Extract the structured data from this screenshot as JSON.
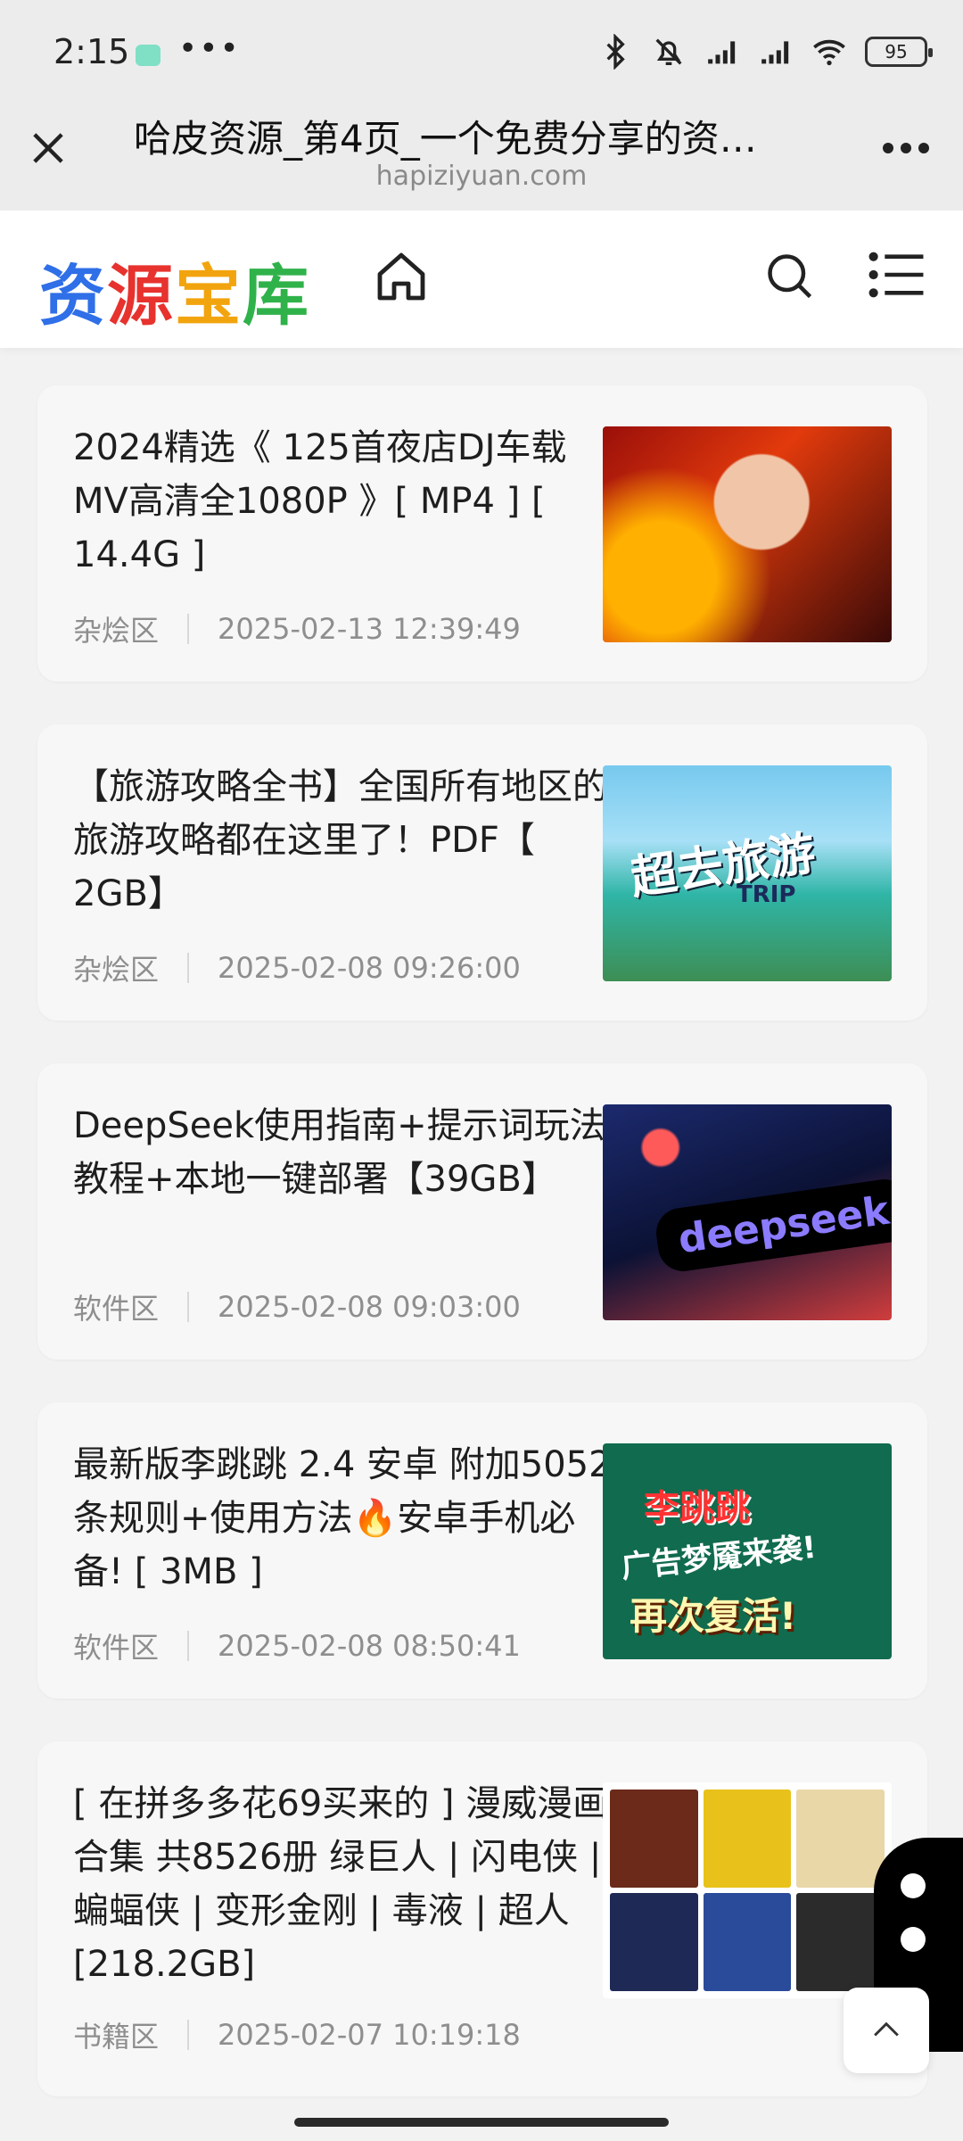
{
  "status_bar": {
    "time": "2:15",
    "more": "•••",
    "battery": "95"
  },
  "browser": {
    "title": "哈皮资源_第4页_一个免费分享的资…",
    "domain": "hapiziyuan.com"
  },
  "site": {
    "logo_chars": [
      "资",
      "源",
      "宝",
      "库"
    ],
    "logo_colors": [
      "#2f6fe8",
      "#e7322e",
      "#f2a40f",
      "#2fb24a"
    ]
  },
  "articles": [
    {
      "title": "2024精选《 125首夜店DJ车载MV高清全1080P 》[ MP4 ] [ 14.4G ]",
      "category": "杂烩区",
      "date": "2025-02-13 12:39:49",
      "thumb_text": []
    },
    {
      "title": "【旅游攻略全书】全国所有地区的旅游攻略都在这里了！PDF【 2GB】",
      "category": "杂烩区",
      "date": "2025-02-08 09:26:00",
      "thumb_text": [
        "超去旅游",
        "TRIP"
      ]
    },
    {
      "title": "DeepSeek使用指南+提示词玩法教程+本地一键部署【39GB】",
      "category": "软件区",
      "date": "2025-02-08 09:03:00",
      "thumb_text": [
        "deepseek"
      ]
    },
    {
      "title": "最新版李跳跳 2.4 安卓 附加5052条规则+使用方法🔥安卓手机必备! [ 3MB ]",
      "category": "软件区",
      "date": "2025-02-08 08:50:41",
      "thumb_text": [
        "李跳跳",
        "广告梦魇来袭!",
        "再次复活!"
      ]
    },
    {
      "title": "[ 在拼多多花69买来的 ] 漫威漫画合集 共8526册 绿巨人 | 闪电侠 | 蝙蝠侠 | 变形金刚 | 毒液 | 超人 [218.2GB]",
      "category": "书籍区",
      "date": "2025-02-07 10:19:18",
      "thumb_text": []
    }
  ],
  "icons": {
    "close": "close-icon",
    "menu": "more-horizontal-icon",
    "home": "home-icon",
    "search": "search-icon",
    "list": "list-menu-icon",
    "to_top": "chevron-up-icon"
  }
}
